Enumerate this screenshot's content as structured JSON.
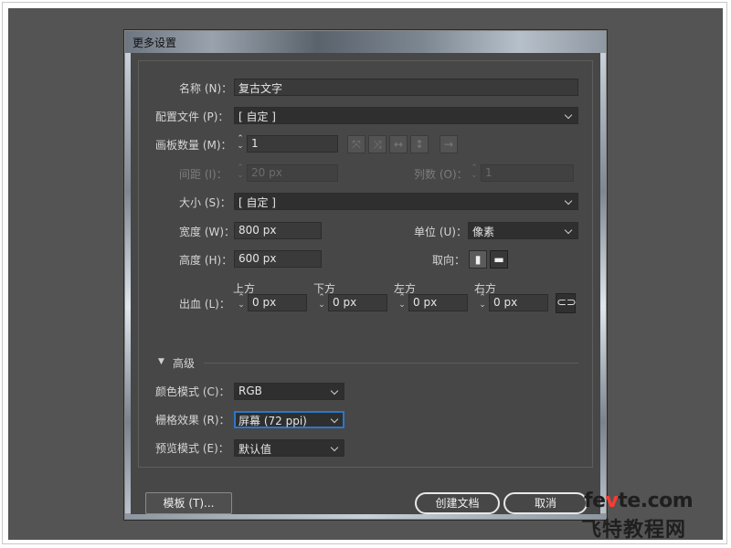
{
  "dialog": {
    "title": "更多设置"
  },
  "form": {
    "name_label": "名称 (N)：",
    "name_value": "复古文字",
    "profile_label": "配置文件 (P)：",
    "profile_value": "[ 自定 ]",
    "artboard_count_label": "画板数量 (M)：",
    "artboard_count_value": "1",
    "arrange_arrow": "→",
    "spacing_label": "间距 (I)：",
    "spacing_value": "20 px",
    "columns_label": "列数 (O)：",
    "columns_value": "1",
    "size_label": "大小 (S)：",
    "size_value": "[ 自定 ]",
    "width_label": "宽度 (W)：",
    "width_value": "800 px",
    "units_label": "单位 (U)：",
    "units_value": "像素",
    "height_label": "高度 (H)：",
    "height_value": "600 px",
    "orientation_label": "取向：",
    "bleed_label": "出血 (L)：",
    "bleed": [
      {
        "label": "上方",
        "value": "0 px"
      },
      {
        "label": "下方",
        "value": "0 px"
      },
      {
        "label": "左方",
        "value": "0 px"
      },
      {
        "label": "右方",
        "value": "0 px"
      }
    ]
  },
  "advanced": {
    "toggle_label": "高级",
    "color_mode_label": "颜色模式 (C)：",
    "color_mode_value": "RGB",
    "raster_label": "栅格效果 (R)：",
    "raster_value": "屏幕 (72 ppi)",
    "preview_label": "预览模式 (E)：",
    "preview_value": "默认值"
  },
  "buttons": {
    "templates": "模板 (T)...",
    "create": "创建文档",
    "cancel": "取消"
  },
  "watermark": {
    "top_prefix": "fe",
    "top_accent": "v",
    "top_suffix": "te.com",
    "bottom": "飞特教程网"
  },
  "icons": {
    "spinner": "spinner-arrows-icon",
    "grid_by_row": "grid-by-row-icon",
    "grid_by_column": "grid-by-column-icon",
    "arrange_row": "arrange-by-row-icon",
    "arrange_column": "arrange-by-column-icon",
    "portrait": "portrait-orientation-icon",
    "landscape": "landscape-orientation-icon",
    "link": "chain-link-icon",
    "triangle": "disclosure-triangle-icon"
  },
  "colors": {
    "dialog_bg": "#474747",
    "field_bg": "#3a3a3a",
    "focus_border": "#2d76c9",
    "watermark_accent": "#ff3b30"
  }
}
